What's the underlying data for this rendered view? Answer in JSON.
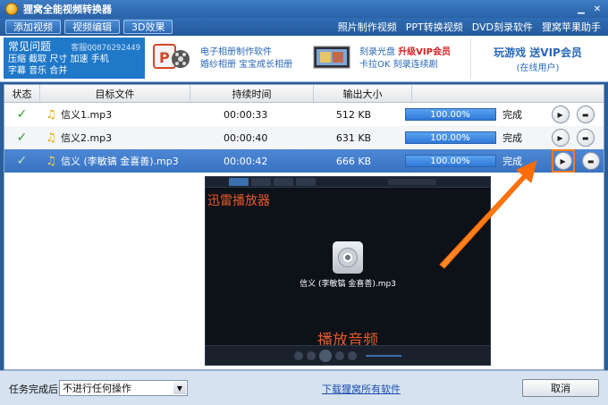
{
  "app": {
    "title": "狸窝全能视频转换器"
  },
  "toolbar": {
    "tabs": [
      "添加视频",
      "视频编辑",
      "3D效果"
    ],
    "links": [
      "照片制作视频",
      "PPT转换视频",
      "DVD刻录软件",
      "狸窝苹果助手"
    ]
  },
  "promo": {
    "faq_title": "常见问题",
    "faq_contact": "客服QQ876292449",
    "faq_line1": "压缩 截取 尺寸 加速 手机",
    "faq_line2": "字幕 音乐 合并",
    "album_line1": "电子相册制作软件",
    "album_line2": "婚纱相册 宝宝成长相册",
    "burn_line1_a": "刻录光盘",
    "burn_line1_b": "升级VIP会员",
    "burn_line2": "卡拉OK 刻录连续剧",
    "vip_main": "玩游戏 送VIP会员",
    "vip_sub": "(在线用户)"
  },
  "table": {
    "headers": [
      "状态",
      "目标文件",
      "持续时间",
      "输出大小"
    ],
    "rows": [
      {
        "file": "信义1.mp3",
        "duration": "00:00:33",
        "size": "512 KB",
        "progress": "100.00%",
        "status": "完成"
      },
      {
        "file": "信义2.mp3",
        "duration": "00:00:40",
        "size": "631 KB",
        "progress": "100.00%",
        "status": "完成"
      },
      {
        "file": "信义 (李敏镐 金喜善).mp3",
        "duration": "00:00:42",
        "size": "666 KB",
        "progress": "100.00%",
        "status": "完成"
      }
    ]
  },
  "player": {
    "title": "迅雷播放器",
    "file": "信义 (李敏镐 金喜善).mp3",
    "caption": "播放音频"
  },
  "bottom": {
    "after_label": "任务完成后:",
    "after_value": "不进行任何操作",
    "download_link": "下载狸窝所有软件",
    "cancel": "取消"
  },
  "colors": {
    "accent": "#2a62a7",
    "highlight": "#ff7a1a"
  }
}
